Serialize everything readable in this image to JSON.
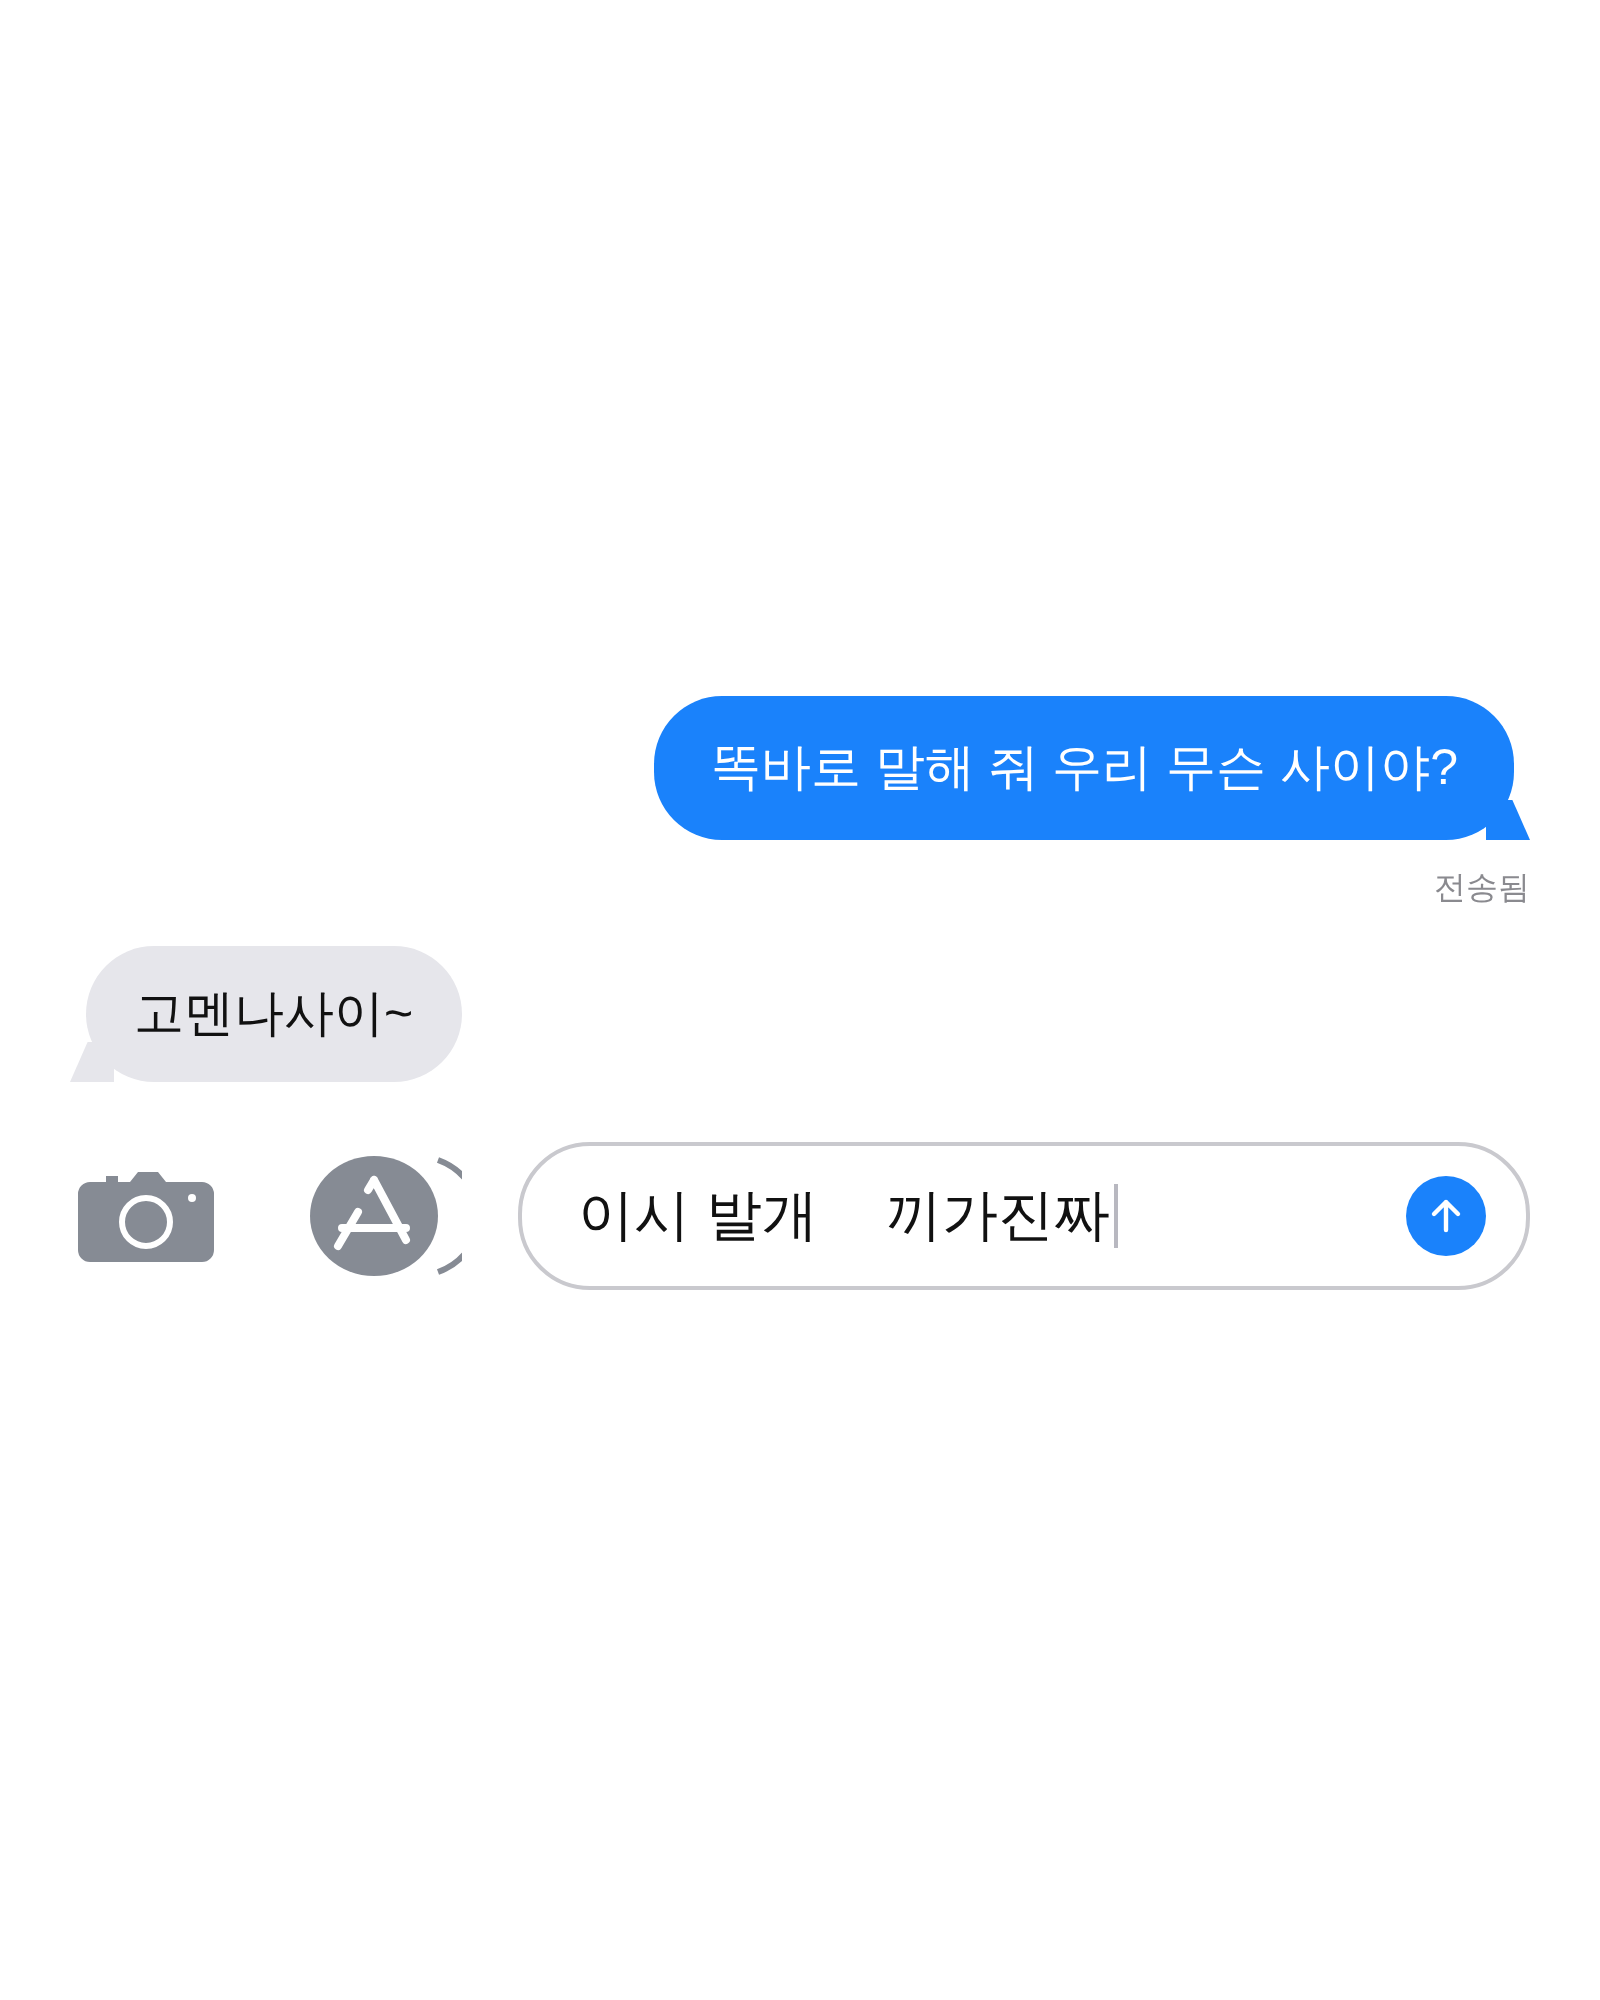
{
  "messages": [
    {
      "kind": "sent",
      "text": "똑바로 말해 줘 우리 무슨 사이야?",
      "status": "전송됨"
    },
    {
      "kind": "received",
      "text": "고멘나사이~"
    }
  ],
  "compose": {
    "value_parts": [
      "이시 발개",
      "끼가진짜"
    ]
  }
}
